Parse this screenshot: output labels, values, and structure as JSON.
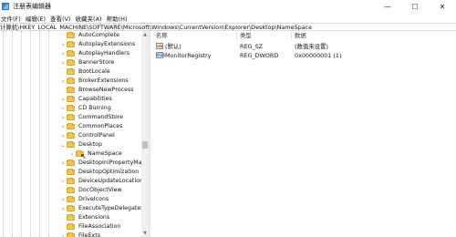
{
  "window": {
    "title": "注册表编辑器",
    "controls": {
      "minimize": "—",
      "maximize": "☐",
      "close": "✕"
    }
  },
  "menu": {
    "items": [
      "文件(F)",
      "编辑(E)",
      "查看(V)",
      "收藏夹(A)",
      "帮助(H)"
    ]
  },
  "address": {
    "path": "计算机\\HKEY_LOCAL_MACHINE\\SOFTWARE\\Microsoft\\Windows\\CurrentVersion\\Explorer\\Desktop\\NameSpace"
  },
  "tree": {
    "items": [
      {
        "label": "AutoComplete",
        "expandable": false
      },
      {
        "label": "AutoplayExtensions",
        "expandable": true
      },
      {
        "label": "AutoplayHandlers",
        "expandable": true
      },
      {
        "label": "BannerStore",
        "expandable": true
      },
      {
        "label": "BootLocale",
        "expandable": false
      },
      {
        "label": "BrokerExtensions",
        "expandable": true
      },
      {
        "label": "BrowseNewProcess",
        "expandable": false
      },
      {
        "label": "Capabilities",
        "expandable": true
      },
      {
        "label": "CD Burning",
        "expandable": true
      },
      {
        "label": "CommandStore",
        "expandable": true
      },
      {
        "label": "CommonPlaces",
        "expandable": true
      },
      {
        "label": "ControlPanel",
        "expandable": true
      },
      {
        "label": "Desktop",
        "expandable": true,
        "expanded": true
      },
      {
        "label": "NameSpace",
        "expandable": true,
        "child": true,
        "selected": true
      },
      {
        "label": "DesktopIniPropertyMap",
        "expandable": true
      },
      {
        "label": "DesktopOptimization",
        "expandable": false
      },
      {
        "label": "DeviceUpdateLocations",
        "expandable": true
      },
      {
        "label": "DocObjectView",
        "expandable": false
      },
      {
        "label": "DriveIcons",
        "expandable": true
      },
      {
        "label": "ExecuteTypeDelegates",
        "expandable": true
      },
      {
        "label": "Extensions",
        "expandable": false
      },
      {
        "label": "FileAssociation",
        "expandable": false
      },
      {
        "label": "FileExts",
        "expandable": true
      }
    ]
  },
  "values": {
    "headers": {
      "name": "名称",
      "type": "类型",
      "data": "数据"
    },
    "rows": [
      {
        "icon": "string-value-icon",
        "icon_text": "ab",
        "name": "(默认)",
        "type": "REG_SZ",
        "data": "(数值未设置)"
      },
      {
        "icon": "binary-value-icon",
        "icon_text": "011",
        "name": "MonitorRegistry",
        "type": "REG_DWORD",
        "data": "0x00000001 (1)"
      }
    ]
  },
  "colors": {
    "folder": "#f3c54c",
    "scroll_thumb": "#c1c1c1",
    "string_icon": "#c0392b",
    "binary_icon": "#2f5fb3"
  }
}
